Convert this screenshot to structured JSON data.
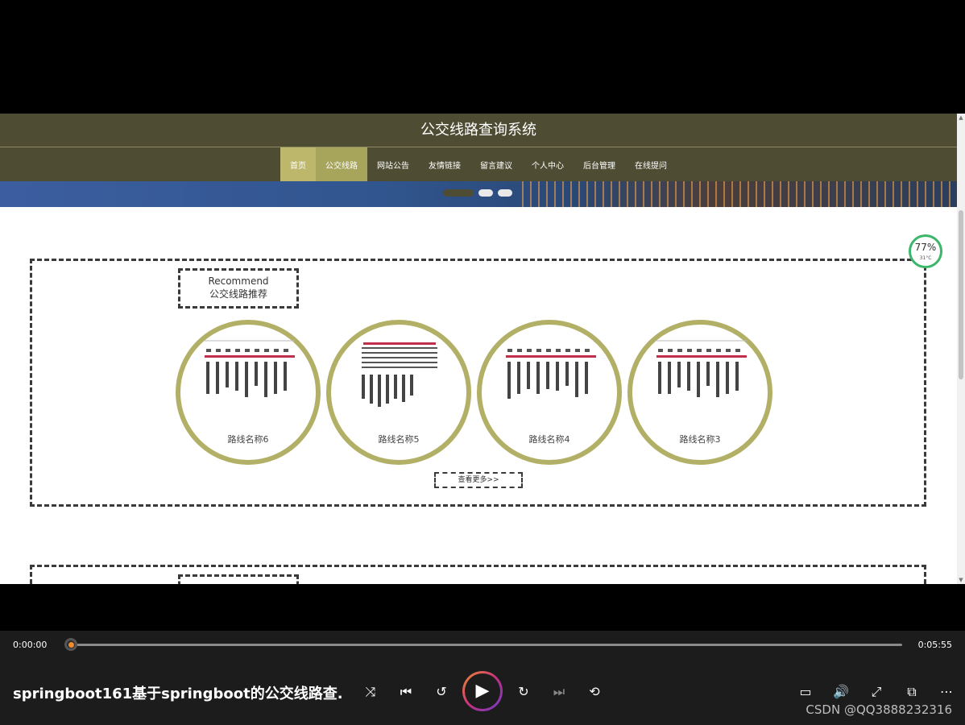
{
  "page": {
    "title": "公交线路查询系统",
    "nav": [
      "首页",
      "公交线路",
      "网站公告",
      "友情链接",
      "留言建议",
      "个人中心",
      "后台管理",
      "在线提问"
    ],
    "recommend": {
      "title_en": "Recommend",
      "title_cn": "公交线路推荐",
      "routes": [
        "路线名称6",
        "路线名称5",
        "路线名称4",
        "路线名称3"
      ],
      "more": "查看更多>>"
    },
    "perf_badge": {
      "value": "77%",
      "temp": "31°C"
    }
  },
  "player": {
    "current_time": "0:00:00",
    "total_time": "0:05:55",
    "title": "springboot161基于springboot的公交线路查...",
    "watermark": "CSDN @QQ3888232316",
    "progress": 0.0
  },
  "icons": {
    "shuffle": "⤨",
    "prev": "⏮",
    "rewind10": "↺",
    "play": "▶",
    "forward30": "↻",
    "next": "⏭",
    "repeat": "⟲",
    "subtitles": "▭",
    "volume": "🔊",
    "fullscreen": "⤢",
    "pip": "⧉",
    "more": "⋯"
  },
  "colors": {
    "header": "#4e4d33",
    "nav_active": "#bdb76b",
    "card_border": "#b2b066",
    "accent": "#f28b2b"
  }
}
